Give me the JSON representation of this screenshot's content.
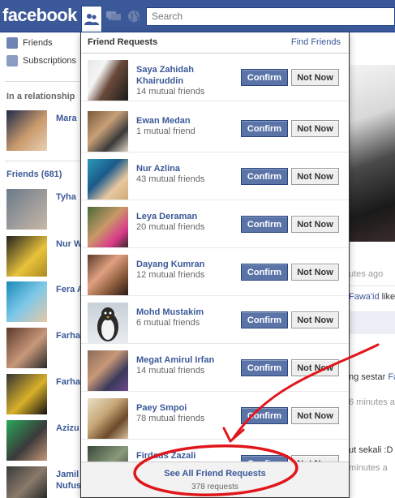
{
  "topbar": {
    "logo": "facebook",
    "search_placeholder": "Search",
    "icons": [
      "friend-requests-icon",
      "messages-icon",
      "notifications-icon"
    ]
  },
  "sidebar": {
    "links": [
      {
        "label": "Friends",
        "icon": "friends-icon"
      },
      {
        "label": "Subscriptions",
        "icon": "rss-icon"
      }
    ],
    "relationship_heading": "In a relationship",
    "relationship_name": "Mara",
    "friends_heading": "Friends (681)",
    "friends": [
      "Tyha",
      "Nur W",
      "Fera A",
      "Farha",
      "Farha",
      "Azizu",
      "Jamil",
      "Nufus"
    ]
  },
  "background_right": {
    "time1": "utes ago",
    "activity1_name": "Fawa'id",
    "activity1_text": " like",
    "text2_a": "ng sestar ",
    "text2_b": "Fa",
    "time2": "6 minutes a",
    "text3": "ut sekali :D",
    "time3": "minutes a"
  },
  "dropdown": {
    "title": "Friend Requests",
    "find_friends": "Find Friends",
    "confirm_label": "Confirm",
    "not_now_label": "Not Now",
    "requests": [
      {
        "name": "Saya Zahidah Khairuddin",
        "mutual": "14 mutual friends"
      },
      {
        "name": "Ewan Medan",
        "mutual": "1 mutual friend"
      },
      {
        "name": "Nur Azlina",
        "mutual": "43 mutual friends"
      },
      {
        "name": "Leya Deraman",
        "mutual": "20 mutual friends"
      },
      {
        "name": "Dayang Kumran",
        "mutual": "12 mutual friends"
      },
      {
        "name": "Mohd Mustakim",
        "mutual": "6 mutual friends"
      },
      {
        "name": "Megat Amirul Irfan",
        "mutual": "14 mutual friends"
      },
      {
        "name": "Paey Smpoi",
        "mutual": "78 mutual friends"
      },
      {
        "name": "Firdaus Zazali",
        "mutual": ""
      }
    ],
    "footer_link": "See All Friend Requests",
    "footer_count": "378 requests"
  },
  "colors": {
    "brand": "#3b5998",
    "annotation": "#e0161b"
  }
}
